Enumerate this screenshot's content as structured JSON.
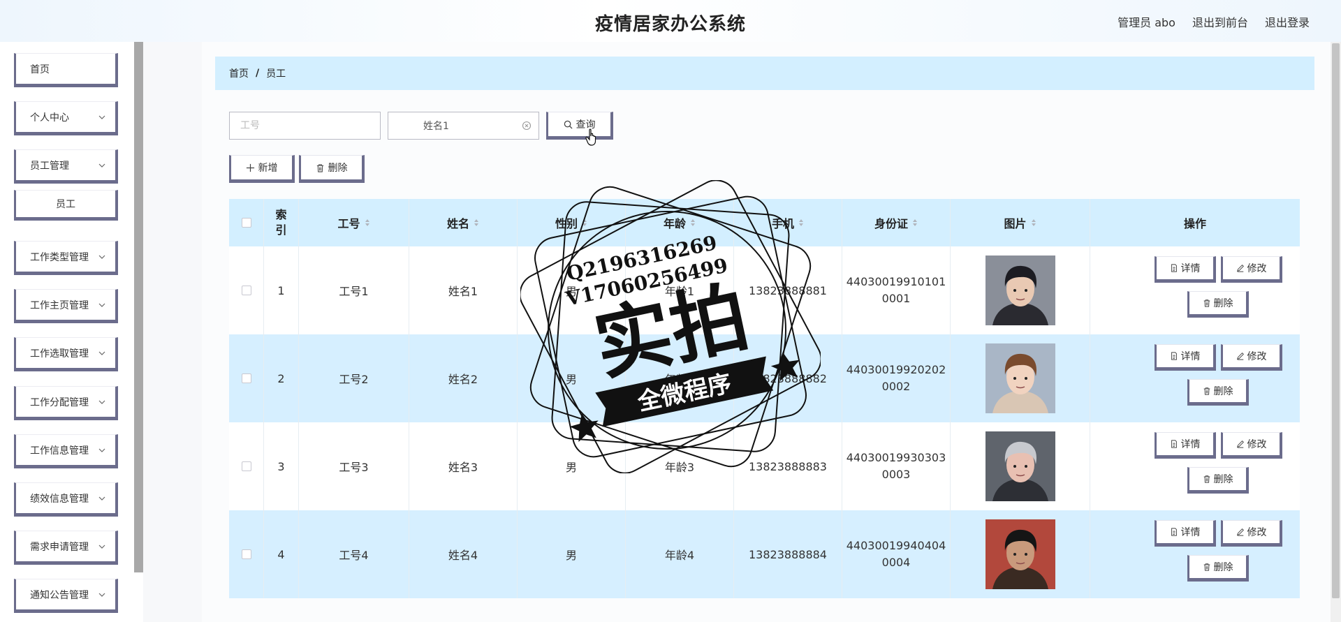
{
  "header": {
    "title": "疫情居家办公系统",
    "user": "管理员 abo",
    "front_link": "退出到前台",
    "logout": "退出登录"
  },
  "sidebar": {
    "items": [
      {
        "label": "首页",
        "expandable": false
      },
      {
        "label": "个人中心",
        "expandable": true
      },
      {
        "label": "员工管理",
        "expandable": true
      },
      {
        "label": "员工",
        "expandable": false,
        "sub": true
      },
      {
        "label": "工作类型管理",
        "expandable": true
      },
      {
        "label": "工作主页管理",
        "expandable": true
      },
      {
        "label": "工作选取管理",
        "expandable": true
      },
      {
        "label": "工作分配管理",
        "expandable": true
      },
      {
        "label": "工作信息管理",
        "expandable": true
      },
      {
        "label": "绩效信息管理",
        "expandable": true
      },
      {
        "label": "需求申请管理",
        "expandable": true
      },
      {
        "label": "通知公告管理",
        "expandable": true
      }
    ]
  },
  "breadcrumb": {
    "home": "首页",
    "separator": "/",
    "current": "员工"
  },
  "search": {
    "id_placeholder": "工号",
    "id_value": "",
    "name_placeholder": "姓名",
    "name_value": "姓名1",
    "search_label": "查询"
  },
  "actions": {
    "add_label": "新增",
    "delete_label": "删除"
  },
  "table": {
    "columns": {
      "index": "索引",
      "emp_id": "工号",
      "name": "姓名",
      "gender": "性别",
      "age": "年龄",
      "phone": "手机",
      "id_card": "身份证",
      "photo": "图片",
      "ops": "操作"
    },
    "rows": [
      {
        "index": "1",
        "emp_id": "工号1",
        "name": "姓名1",
        "gender": "男",
        "age": "年龄1",
        "phone": "13823888881",
        "id_card_1": "44030019910101",
        "id_card_2": "0001"
      },
      {
        "index": "2",
        "emp_id": "工号2",
        "name": "姓名2",
        "gender": "男",
        "age": "年龄2",
        "phone": "13823888882",
        "id_card_1": "44030019920202",
        "id_card_2": "0002"
      },
      {
        "index": "3",
        "emp_id": "工号3",
        "name": "姓名3",
        "gender": "男",
        "age": "年龄3",
        "phone": "13823888883",
        "id_card_1": "44030019930303",
        "id_card_2": "0003"
      },
      {
        "index": "4",
        "emp_id": "工号4",
        "name": "姓名4",
        "gender": "男",
        "age": "年龄4",
        "phone": "13823888884",
        "id_card_1": "44030019940404",
        "id_card_2": "0004"
      }
    ],
    "op_labels": {
      "detail": "详情",
      "edit": "修改",
      "delete": "删除"
    }
  },
  "stamp": {
    "line1": "Q2196316269",
    "line2": "V17060256499",
    "big": "实拍",
    "banner": "全微程序"
  },
  "colors": {
    "accent": "#6b6c8c",
    "breadcrumb_bg": "#d3efff",
    "row_alt": "#d6efff"
  }
}
